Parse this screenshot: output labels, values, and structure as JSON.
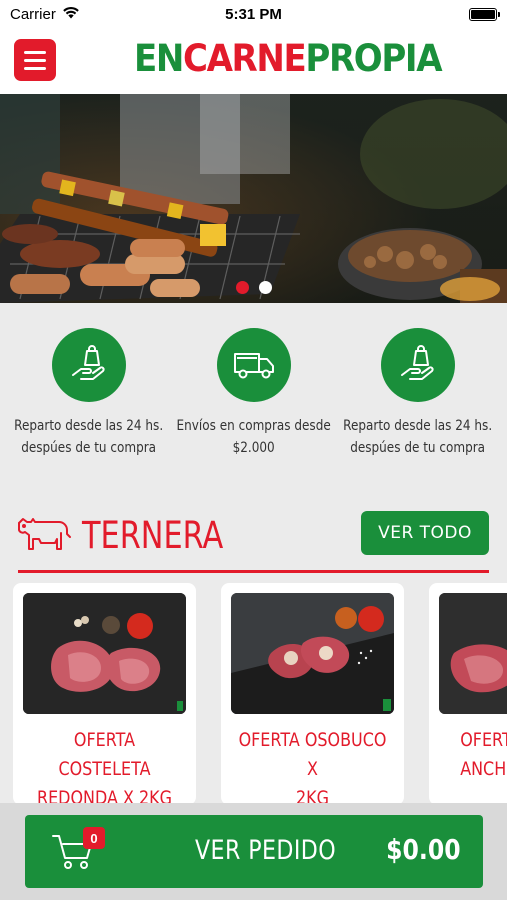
{
  "status_bar": {
    "carrier": "Carrier",
    "time": "5:31 PM"
  },
  "header": {
    "logo": {
      "part1": "EN",
      "part2": "CARNE",
      "part3": "PROPIA"
    },
    "menu_icon": "hamburger-menu-icon"
  },
  "banner": {
    "slide_count": 2,
    "active_slide": 1
  },
  "features": [
    {
      "icon": "hand-bag-icon",
      "line1": "Reparto desde las 24 hs.",
      "line2": "despúes de tu compra"
    },
    {
      "icon": "truck-icon",
      "line1": "Envíos en compras desde",
      "line2": "$2.000"
    },
    {
      "icon": "hand-bag-icon",
      "line1": "Reparto desde las 24 hs.",
      "line2": "despúes de tu compra"
    }
  ],
  "section": {
    "title": "TERNERA",
    "icon": "cow-icon",
    "ver_todo_label": "VER TODO"
  },
  "products": [
    {
      "line1": "OFERTA COSTELETA",
      "line2": "REDONDA X 2KG"
    },
    {
      "line1": "OFERTA OSOBUCO X",
      "line2": "2KG"
    },
    {
      "line1": "OFERTA C",
      "line2": "ANCH"
    }
  ],
  "order": {
    "label": "VER PEDIDO",
    "total": "$0.00",
    "cart_count": "0"
  },
  "colors": {
    "brand_red": "#e21b2b",
    "brand_green": "#1a8f3b"
  }
}
